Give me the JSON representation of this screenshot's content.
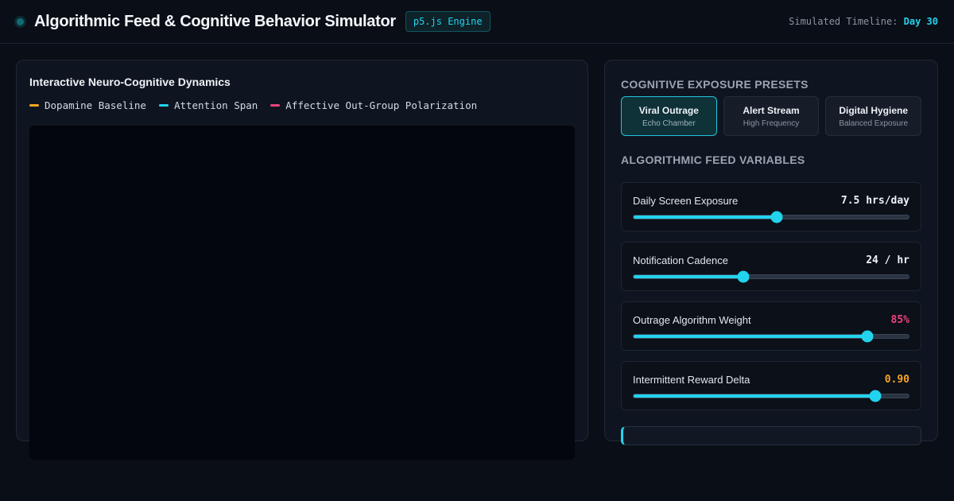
{
  "header": {
    "title": "Algorithmic Feed & Cognitive Behavior Simulator",
    "engine_badge": "p5.js Engine",
    "timeline_label": "Simulated Timeline:",
    "timeline_day": "Day 30"
  },
  "left_panel": {
    "title": "Interactive Neuro-Cognitive Dynamics",
    "legend": [
      {
        "label": "Dopamine Baseline",
        "color": "#f5a524"
      },
      {
        "label": "Attention Span",
        "color": "#22d3ee"
      },
      {
        "label": "Affective Out-Group Polarization",
        "color": "#f0437d"
      }
    ]
  },
  "right_panel": {
    "presets_heading": "COGNITIVE EXPOSURE PRESETS",
    "presets": [
      {
        "name": "Viral Outrage",
        "sub": "Echo Chamber",
        "active": true
      },
      {
        "name": "Alert Stream",
        "sub": "High Frequency",
        "active": false
      },
      {
        "name": "Digital Hygiene",
        "sub": "Balanced Exposure",
        "active": false
      }
    ],
    "variables_heading": "ALGORITHMIC FEED VARIABLES",
    "variables": [
      {
        "label": "Daily Screen Exposure",
        "value": "7.5 hrs/day",
        "level": 0.52
      },
      {
        "label": "Notification Cadence",
        "value": "24 / hr",
        "level": 0.4
      },
      {
        "label": "Outrage Algorithm Weight",
        "value": "85%",
        "level": 0.85
      },
      {
        "label": "Intermittent Reward Delta",
        "value": "0.90",
        "level": 0.88
      }
    ]
  },
  "colors": {
    "accent": "#22d3ee",
    "pink": "#f0437d",
    "amber": "#f5a524"
  }
}
